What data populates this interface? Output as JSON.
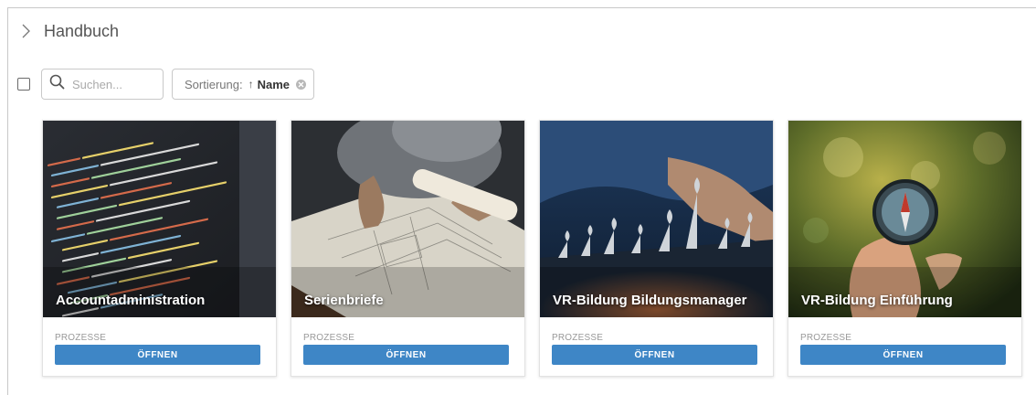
{
  "header": {
    "title": "Handbuch"
  },
  "toolbar": {
    "search_placeholder": "Suchen...",
    "sort_label": "Sortierung:",
    "sort_arrow": "↑",
    "sort_value": "Name"
  },
  "colors": {
    "button": "#3e86c6",
    "background": "#ffffff"
  },
  "cards": [
    {
      "title": "Accountadministration",
      "category": "PROZESSE",
      "button": "ÖFFNEN",
      "image": "code-editor-photo"
    },
    {
      "title": "Serienbriefe",
      "category": "PROZESSE",
      "button": "ÖFFNEN",
      "image": "blueprint-drawing-photo"
    },
    {
      "title": "VR-Bildung Bildungsmanager",
      "category": "PROZESSE",
      "button": "ÖFFNEN",
      "image": "chess-photo"
    },
    {
      "title": "VR-Bildung Einführung",
      "category": "PROZESSE",
      "button": "ÖFFNEN",
      "image": "compass-photo"
    }
  ]
}
